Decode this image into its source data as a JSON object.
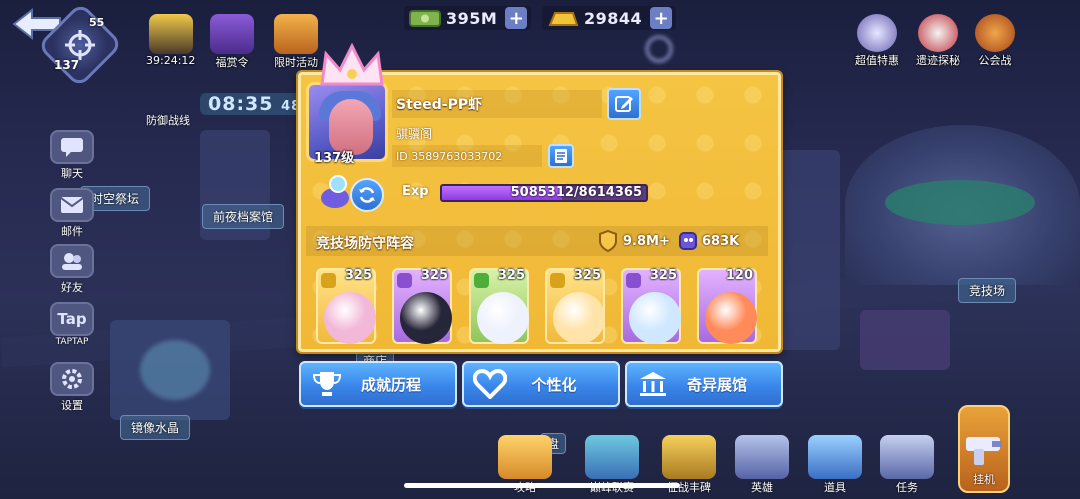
{
  "top_bar": {
    "player_level_small": "55",
    "player_level": "137",
    "currency": [
      {
        "name": "cash",
        "value": "395M",
        "icon": "cash-icon"
      },
      {
        "name": "gold",
        "value": "29844",
        "icon": "gold-bar-icon"
      }
    ],
    "left_icons": [
      {
        "label": "39:24:12",
        "icon": "treasure-chest-icon"
      },
      {
        "label": "福赏令",
        "icon": "purple-box-icon"
      },
      {
        "label": "限时活动",
        "icon": "gift-icon"
      }
    ],
    "right_icons": [
      {
        "label": "超值特惠",
        "icon": "special-offer-icon"
      },
      {
        "label": "遗迹探秘",
        "icon": "skull-icon"
      },
      {
        "label": "公会战",
        "icon": "guild-war-icon"
      }
    ]
  },
  "side_menu": [
    {
      "label": "聊天",
      "icon": "chat-icon"
    },
    {
      "label": "邮件",
      "icon": "mail-icon"
    },
    {
      "label": "好友",
      "icon": "friends-icon"
    },
    {
      "label": "TAPTAP",
      "icon": "taptap-icon",
      "icon_text": "Tap"
    },
    {
      "label": "设置",
      "icon": "settings-gear-icon"
    }
  ],
  "map": {
    "timer": "08:35",
    "timer_suffix": "48",
    "defense_label": "防御战线",
    "labels": {
      "time_altar": "时空祭坛",
      "eve_archive": "前夜档案馆",
      "mirror_crystal": "镜像水晶",
      "arena": "竞技场",
      "shop": "商店",
      "plate": "盘"
    }
  },
  "profile": {
    "name": "Steed-PP虾",
    "guild": "骐骥阁",
    "id": "ID 3589763033702",
    "level_badge": "137级",
    "exp_label": "Exp",
    "exp_current": 5085312,
    "exp_max": 8614365,
    "exp_text": "5085312/8614365",
    "section_title": "竞技场防守阵容",
    "power_value": "9.8M",
    "power_plus": "+",
    "power2_value": "683K",
    "accent_color": "#f5c443"
  },
  "heroes": [
    {
      "level": "325",
      "tag": "yellow",
      "color": "#ffcf4a"
    },
    {
      "level": "325",
      "tag": "purple",
      "color": "#c77ee8"
    },
    {
      "level": "325",
      "tag": "green",
      "color": "#b8e36b"
    },
    {
      "level": "325",
      "tag": "yellow",
      "color": "#ffcf4a"
    },
    {
      "level": "325",
      "tag": "purple",
      "color": "#c77ee8"
    },
    {
      "level": "120",
      "tag": "none",
      "color": "#c77ee8"
    }
  ],
  "actions": [
    {
      "label": "成就历程",
      "icon": "trophy-icon"
    },
    {
      "label": "个性化",
      "icon": "heart-icon"
    },
    {
      "label": "奇异展馆",
      "icon": "museum-icon"
    }
  ],
  "bottom_bar": [
    {
      "label": "攻略",
      "icon": "guide-icon"
    },
    {
      "label": "巅峰联赛",
      "icon": "peak-league-icon"
    },
    {
      "label": "征战丰碑",
      "icon": "monument-icon"
    },
    {
      "label": "英雄",
      "icon": "hero-icon"
    },
    {
      "label": "道具",
      "icon": "items-icon"
    },
    {
      "label": "任务",
      "icon": "tasks-icon"
    },
    {
      "label": "挂机",
      "icon": "idle-gun-icon"
    }
  ]
}
